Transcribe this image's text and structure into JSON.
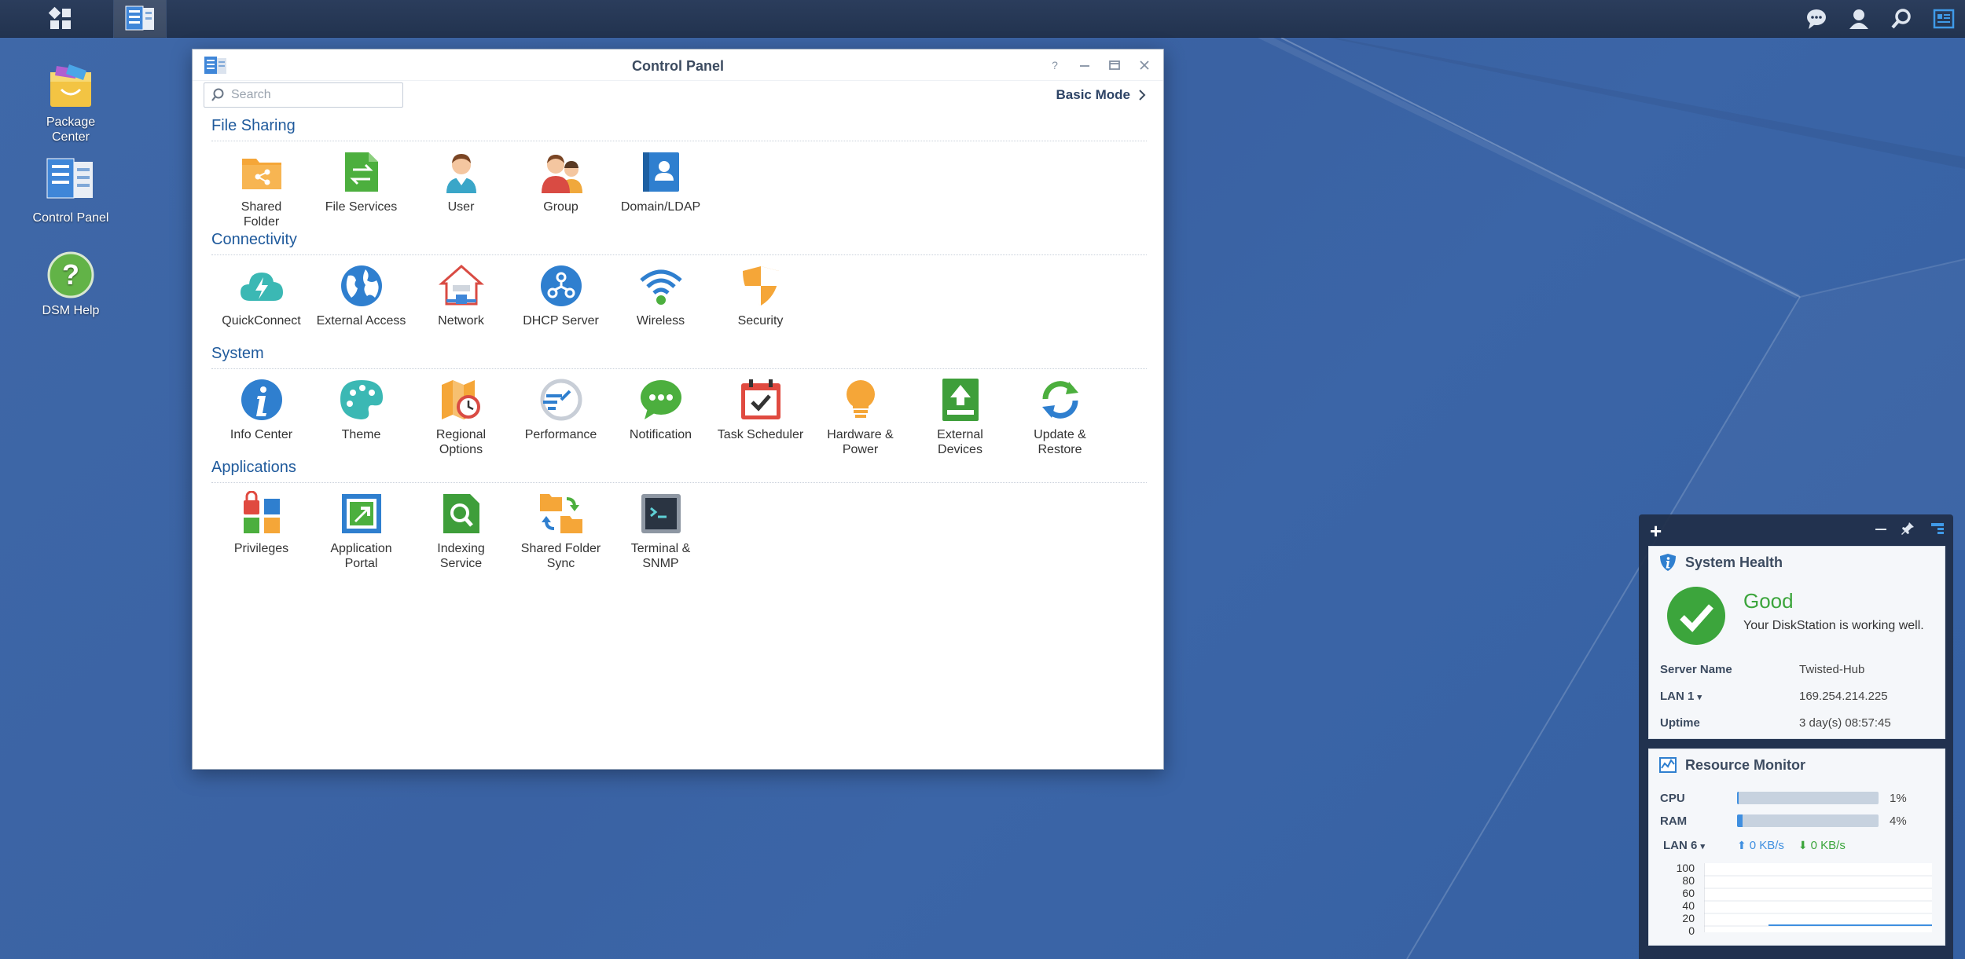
{
  "desktop": {
    "icons": [
      {
        "label_line1": "Package",
        "label_line2": "Center"
      },
      {
        "label_line1": "Control Panel",
        "label_line2": ""
      },
      {
        "label_line1": "DSM Help",
        "label_line2": ""
      }
    ]
  },
  "window": {
    "title": "Control Panel",
    "search_placeholder": "Search",
    "basic_mode_label": "Basic Mode"
  },
  "sections": [
    {
      "title": "File Sharing",
      "items": [
        {
          "l1": "Shared",
          "l2": "Folder",
          "icon": "shared-folder-icon"
        },
        {
          "l1": "File Services",
          "l2": "",
          "icon": "file-services-icon"
        },
        {
          "l1": "User",
          "l2": "",
          "icon": "user-icon"
        },
        {
          "l1": "Group",
          "l2": "",
          "icon": "group-icon"
        },
        {
          "l1": "Domain/LDAP",
          "l2": "",
          "icon": "domain-ldap-icon"
        }
      ]
    },
    {
      "title": "Connectivity",
      "items": [
        {
          "l1": "QuickConnect",
          "l2": "",
          "icon": "quickconnect-icon"
        },
        {
          "l1": "External Access",
          "l2": "",
          "icon": "external-access-icon"
        },
        {
          "l1": "Network",
          "l2": "",
          "icon": "network-icon"
        },
        {
          "l1": "DHCP Server",
          "l2": "",
          "icon": "dhcp-server-icon"
        },
        {
          "l1": "Wireless",
          "l2": "",
          "icon": "wireless-icon"
        },
        {
          "l1": "Security",
          "l2": "",
          "icon": "security-icon"
        }
      ]
    },
    {
      "title": "System",
      "items": [
        {
          "l1": "Info Center",
          "l2": "",
          "icon": "info-center-icon"
        },
        {
          "l1": "Theme",
          "l2": "",
          "icon": "theme-icon"
        },
        {
          "l1": "Regional",
          "l2": "Options",
          "icon": "regional-options-icon"
        },
        {
          "l1": "Performance",
          "l2": "",
          "icon": "performance-icon"
        },
        {
          "l1": "Notification",
          "l2": "",
          "icon": "notification-icon"
        },
        {
          "l1": "Task Scheduler",
          "l2": "",
          "icon": "task-scheduler-icon"
        },
        {
          "l1": "Hardware &",
          "l2": "Power",
          "icon": "hardware-power-icon"
        },
        {
          "l1": "External",
          "l2": "Devices",
          "icon": "external-devices-icon"
        },
        {
          "l1": "Update &",
          "l2": "Restore",
          "icon": "update-restore-icon"
        }
      ]
    },
    {
      "title": "Applications",
      "items": [
        {
          "l1": "Privileges",
          "l2": "",
          "icon": "privileges-icon"
        },
        {
          "l1": "Application",
          "l2": "Portal",
          "icon": "application-portal-icon"
        },
        {
          "l1": "Indexing",
          "l2": "Service",
          "icon": "indexing-service-icon"
        },
        {
          "l1": "Shared Folder",
          "l2": "Sync",
          "icon": "shared-folder-sync-icon"
        },
        {
          "l1": "Terminal &",
          "l2": "SNMP",
          "icon": "terminal-snmp-icon"
        }
      ]
    }
  ],
  "system_health": {
    "title": "System Health",
    "status": "Good",
    "message": "Your DiskStation is working well.",
    "server_name_label": "Server Name",
    "server_name": "Twisted-Hub",
    "lan_label": "LAN 1",
    "lan_ip": "169.254.214.225",
    "uptime_label": "Uptime",
    "uptime": "3 day(s) 08:57:45"
  },
  "resource_monitor": {
    "title": "Resource Monitor",
    "cpu_label": "CPU",
    "cpu_percent": 1,
    "cpu_text": "1%",
    "ram_label": "RAM",
    "ram_percent": 4,
    "ram_text": "4%",
    "lan_label": "LAN 6",
    "upload": "0 KB/s",
    "download": "0 KB/s",
    "chart_ticks": [
      "100",
      "80",
      "60",
      "40",
      "20",
      "0"
    ]
  },
  "colors": {
    "accent": "#1f5a9c",
    "good": "#3ca53c",
    "bar_fill": "#3f8fe0",
    "upload_arrow": "#3f8fe0",
    "download_arrow": "#3ca53c"
  }
}
